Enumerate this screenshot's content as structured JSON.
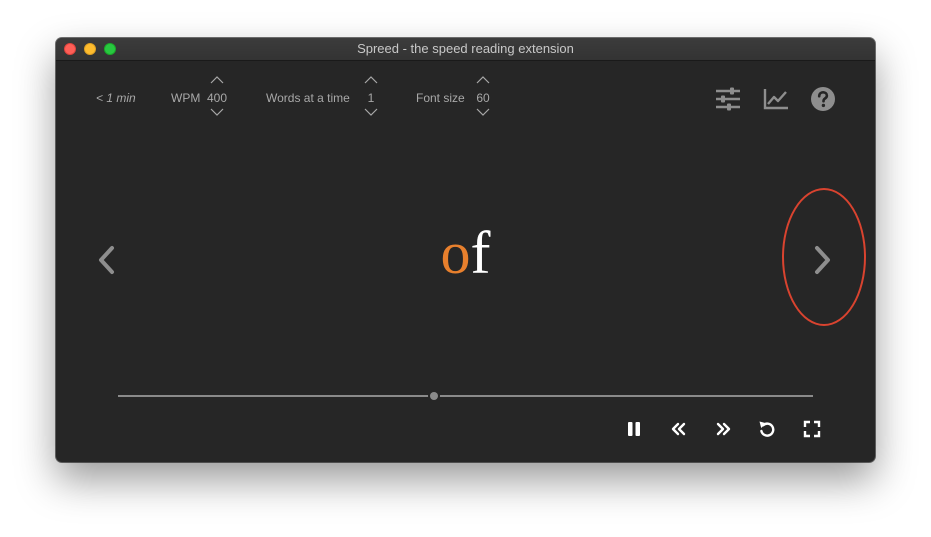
{
  "window": {
    "title": "Spreed - the speed reading extension"
  },
  "toolbar": {
    "time_estimate": "< 1 min",
    "wpm": {
      "label": "WPM",
      "value": "400"
    },
    "words_at_a_time": {
      "label": "Words at a time",
      "value": "1"
    },
    "font_size": {
      "label": "Font size",
      "value": "60"
    },
    "icons": [
      "settings-sliders-icon",
      "stats-chart-icon",
      "help-icon"
    ]
  },
  "reader": {
    "word_focus": "o",
    "word_rest": "f"
  },
  "progress": {
    "fraction": 0.455
  },
  "playback": {
    "icons": [
      "pause-icon",
      "rewind-icon",
      "fast-forward-icon",
      "restart-icon",
      "fullscreen-icon"
    ]
  },
  "colors": {
    "background": "#262626",
    "focus_letter": "#e8802d",
    "word_text": "#ffffff",
    "controls": "#a8a8a8",
    "highlight": "#d9432f"
  }
}
